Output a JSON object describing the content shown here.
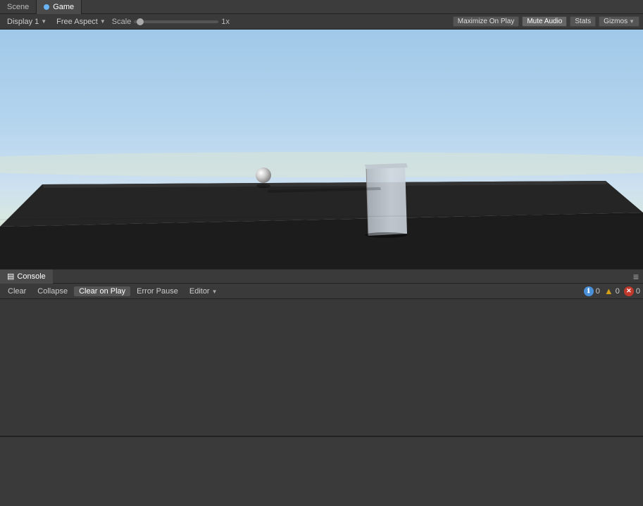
{
  "tabs": {
    "scene_label": "Scene",
    "game_label": "Game",
    "game_dot_color": "#6ab5f5"
  },
  "toolbar": {
    "display_label": "Display 1",
    "aspect_label": "Free Aspect",
    "scale_label": "Scale",
    "scale_value": "1x",
    "maximize_label": "Maximize On Play",
    "mute_label": "Mute Audio",
    "stats_label": "Stats",
    "gizmos_label": "Gizmos"
  },
  "console": {
    "tab_label": "Console",
    "clear_label": "Clear",
    "collapse_label": "Collapse",
    "clear_on_play_label": "Clear on Play",
    "error_pause_label": "Error Pause",
    "editor_label": "Editor",
    "info_count": "0",
    "warn_count": "0",
    "error_count": "0"
  },
  "scene": {
    "has_sphere": true,
    "has_platform": true,
    "has_wall": true
  }
}
